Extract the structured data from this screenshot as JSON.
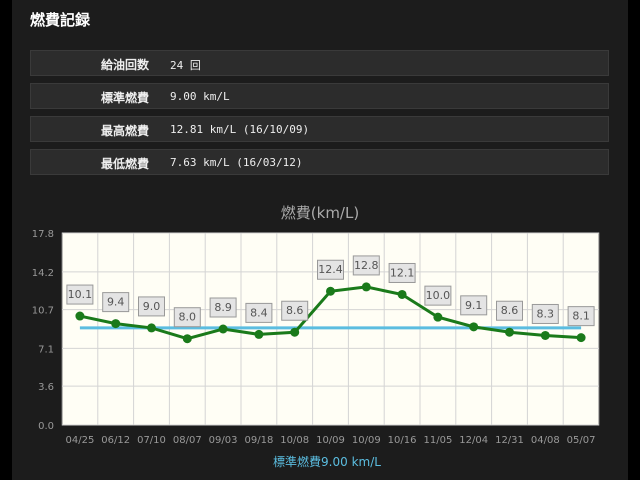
{
  "page": {
    "title": "燃費記録"
  },
  "stats": [
    {
      "label": "給油回数",
      "value": "24 回"
    },
    {
      "label": "標準燃費",
      "value": "9.00 km/L"
    },
    {
      "label": "最高燃費",
      "value": "12.81 km/L (16/10/09)"
    },
    {
      "label": "最低燃費",
      "value": "7.63 km/L (16/03/12)"
    }
  ],
  "colors": {
    "line": "#1a7a1a",
    "reference": "#5bbde0",
    "plot_bg": "#fffef5",
    "label_bg": "#e4e4e4"
  },
  "chart_data": {
    "type": "line",
    "title": "燃費(km/L)",
    "categories": [
      "04/25",
      "06/12",
      "07/10",
      "08/07",
      "09/03",
      "09/18",
      "10/08",
      "10/09",
      "10/09",
      "10/16",
      "11/05",
      "12/04",
      "12/31",
      "04/08",
      "05/07"
    ],
    "series": [
      {
        "values": [
          10.1,
          9.4,
          9.0,
          8.0,
          8.9,
          8.4,
          8.6,
          12.4,
          12.8,
          12.1,
          10.0,
          9.1,
          8.6,
          8.3,
          8.1
        ],
        "labels": [
          "10.1",
          "9.4",
          "9.0",
          "8.0",
          "8.9",
          "8.4",
          "8.6",
          "12.4",
          "12.8",
          "12.1",
          "10.0",
          "9.1",
          "8.6",
          "8.3",
          "8.1"
        ]
      }
    ],
    "reference_line": {
      "value": 9.0,
      "label": "標準燃費9.00 km/L"
    },
    "ylim": [
      0.0,
      17.8
    ],
    "yticks": [
      "0.0",
      "3.6",
      "7.1",
      "10.7",
      "14.2",
      "17.8"
    ],
    "grid": true
  }
}
